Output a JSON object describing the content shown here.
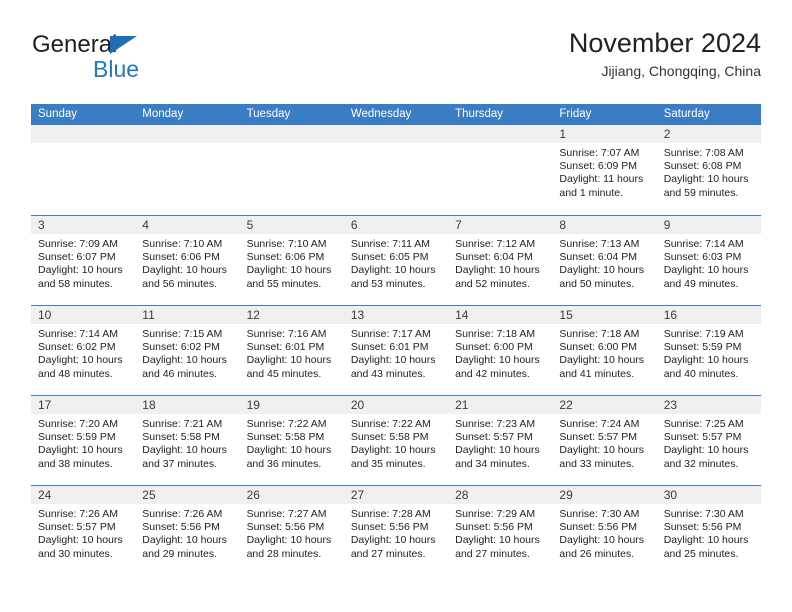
{
  "brand": {
    "name_top": "General",
    "name_bottom": "Blue",
    "triangle_color": "#1f6fb6",
    "blue_color": "#1f7ac0"
  },
  "header": {
    "title": "November 2024",
    "subtitle": "Jijiang, Chongqing, China"
  },
  "theme": {
    "header_blue": "#3b7dc4",
    "date_band": "#f0f0f0",
    "text": "#222222"
  },
  "calendar": {
    "weekday_headers": [
      "Sunday",
      "Monday",
      "Tuesday",
      "Wednesday",
      "Thursday",
      "Friday",
      "Saturday"
    ],
    "weeks": [
      [
        {
          "day": "",
          "empty": true
        },
        {
          "day": "",
          "empty": true
        },
        {
          "day": "",
          "empty": true
        },
        {
          "day": "",
          "empty": true
        },
        {
          "day": "",
          "empty": true
        },
        {
          "day": "1",
          "sunrise": "Sunrise: 7:07 AM",
          "sunset": "Sunset: 6:09 PM",
          "daylight": "Daylight: 11 hours and 1 minute."
        },
        {
          "day": "2",
          "sunrise": "Sunrise: 7:08 AM",
          "sunset": "Sunset: 6:08 PM",
          "daylight": "Daylight: 10 hours and 59 minutes."
        }
      ],
      [
        {
          "day": "3",
          "sunrise": "Sunrise: 7:09 AM",
          "sunset": "Sunset: 6:07 PM",
          "daylight": "Daylight: 10 hours and 58 minutes."
        },
        {
          "day": "4",
          "sunrise": "Sunrise: 7:10 AM",
          "sunset": "Sunset: 6:06 PM",
          "daylight": "Daylight: 10 hours and 56 minutes."
        },
        {
          "day": "5",
          "sunrise": "Sunrise: 7:10 AM",
          "sunset": "Sunset: 6:06 PM",
          "daylight": "Daylight: 10 hours and 55 minutes."
        },
        {
          "day": "6",
          "sunrise": "Sunrise: 7:11 AM",
          "sunset": "Sunset: 6:05 PM",
          "daylight": "Daylight: 10 hours and 53 minutes."
        },
        {
          "day": "7",
          "sunrise": "Sunrise: 7:12 AM",
          "sunset": "Sunset: 6:04 PM",
          "daylight": "Daylight: 10 hours and 52 minutes."
        },
        {
          "day": "8",
          "sunrise": "Sunrise: 7:13 AM",
          "sunset": "Sunset: 6:04 PM",
          "daylight": "Daylight: 10 hours and 50 minutes."
        },
        {
          "day": "9",
          "sunrise": "Sunrise: 7:14 AM",
          "sunset": "Sunset: 6:03 PM",
          "daylight": "Daylight: 10 hours and 49 minutes."
        }
      ],
      [
        {
          "day": "10",
          "sunrise": "Sunrise: 7:14 AM",
          "sunset": "Sunset: 6:02 PM",
          "daylight": "Daylight: 10 hours and 48 minutes."
        },
        {
          "day": "11",
          "sunrise": "Sunrise: 7:15 AM",
          "sunset": "Sunset: 6:02 PM",
          "daylight": "Daylight: 10 hours and 46 minutes."
        },
        {
          "day": "12",
          "sunrise": "Sunrise: 7:16 AM",
          "sunset": "Sunset: 6:01 PM",
          "daylight": "Daylight: 10 hours and 45 minutes."
        },
        {
          "day": "13",
          "sunrise": "Sunrise: 7:17 AM",
          "sunset": "Sunset: 6:01 PM",
          "daylight": "Daylight: 10 hours and 43 minutes."
        },
        {
          "day": "14",
          "sunrise": "Sunrise: 7:18 AM",
          "sunset": "Sunset: 6:00 PM",
          "daylight": "Daylight: 10 hours and 42 minutes."
        },
        {
          "day": "15",
          "sunrise": "Sunrise: 7:18 AM",
          "sunset": "Sunset: 6:00 PM",
          "daylight": "Daylight: 10 hours and 41 minutes."
        },
        {
          "day": "16",
          "sunrise": "Sunrise: 7:19 AM",
          "sunset": "Sunset: 5:59 PM",
          "daylight": "Daylight: 10 hours and 40 minutes."
        }
      ],
      [
        {
          "day": "17",
          "sunrise": "Sunrise: 7:20 AM",
          "sunset": "Sunset: 5:59 PM",
          "daylight": "Daylight: 10 hours and 38 minutes."
        },
        {
          "day": "18",
          "sunrise": "Sunrise: 7:21 AM",
          "sunset": "Sunset: 5:58 PM",
          "daylight": "Daylight: 10 hours and 37 minutes."
        },
        {
          "day": "19",
          "sunrise": "Sunrise: 7:22 AM",
          "sunset": "Sunset: 5:58 PM",
          "daylight": "Daylight: 10 hours and 36 minutes."
        },
        {
          "day": "20",
          "sunrise": "Sunrise: 7:22 AM",
          "sunset": "Sunset: 5:58 PM",
          "daylight": "Daylight: 10 hours and 35 minutes."
        },
        {
          "day": "21",
          "sunrise": "Sunrise: 7:23 AM",
          "sunset": "Sunset: 5:57 PM",
          "daylight": "Daylight: 10 hours and 34 minutes."
        },
        {
          "day": "22",
          "sunrise": "Sunrise: 7:24 AM",
          "sunset": "Sunset: 5:57 PM",
          "daylight": "Daylight: 10 hours and 33 minutes."
        },
        {
          "day": "23",
          "sunrise": "Sunrise: 7:25 AM",
          "sunset": "Sunset: 5:57 PM",
          "daylight": "Daylight: 10 hours and 32 minutes."
        }
      ],
      [
        {
          "day": "24",
          "sunrise": "Sunrise: 7:26 AM",
          "sunset": "Sunset: 5:57 PM",
          "daylight": "Daylight: 10 hours and 30 minutes."
        },
        {
          "day": "25",
          "sunrise": "Sunrise: 7:26 AM",
          "sunset": "Sunset: 5:56 PM",
          "daylight": "Daylight: 10 hours and 29 minutes."
        },
        {
          "day": "26",
          "sunrise": "Sunrise: 7:27 AM",
          "sunset": "Sunset: 5:56 PM",
          "daylight": "Daylight: 10 hours and 28 minutes."
        },
        {
          "day": "27",
          "sunrise": "Sunrise: 7:28 AM",
          "sunset": "Sunset: 5:56 PM",
          "daylight": "Daylight: 10 hours and 27 minutes."
        },
        {
          "day": "28",
          "sunrise": "Sunrise: 7:29 AM",
          "sunset": "Sunset: 5:56 PM",
          "daylight": "Daylight: 10 hours and 27 minutes."
        },
        {
          "day": "29",
          "sunrise": "Sunrise: 7:30 AM",
          "sunset": "Sunset: 5:56 PM",
          "daylight": "Daylight: 10 hours and 26 minutes."
        },
        {
          "day": "30",
          "sunrise": "Sunrise: 7:30 AM",
          "sunset": "Sunset: 5:56 PM",
          "daylight": "Daylight: 10 hours and 25 minutes."
        }
      ]
    ]
  }
}
